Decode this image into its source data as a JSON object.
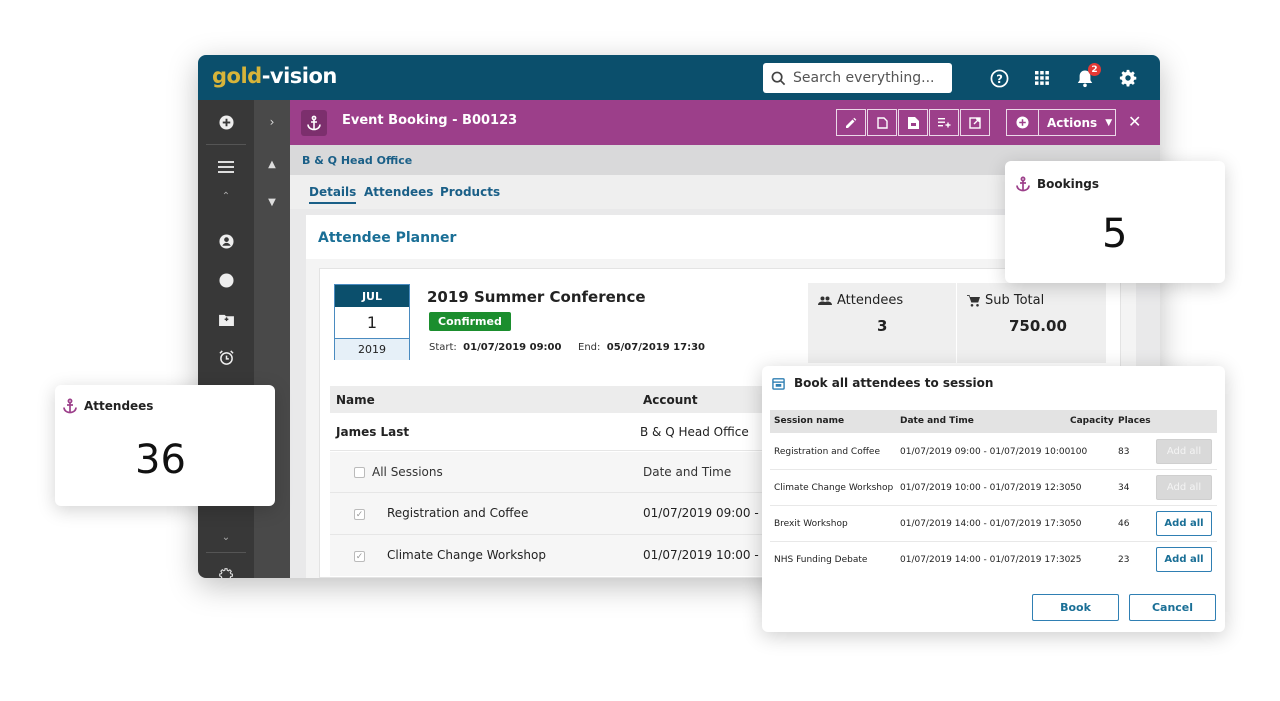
{
  "app": {
    "logo_gold": "gold",
    "logo_rest": "-vision",
    "search_placeholder": "Search everything...",
    "notification_count": "2",
    "colors": {
      "topbar": "#0b4f6c",
      "record_bar": "#9c3f8a",
      "confirmed": "#1b8e2e",
      "link": "#1a5f87"
    }
  },
  "record": {
    "title": "Event Booking - B00123",
    "actions_label": "Actions",
    "breadcrumb": "B & Q Head Office",
    "tabs": [
      "Details",
      "Attendees",
      "Products"
    ]
  },
  "planner": {
    "title": "Attendee Planner",
    "date": {
      "month": "JUL",
      "day": "1",
      "year": "2019"
    },
    "event_name": "2019 Summer Conference",
    "status": "Confirmed",
    "start_label": "Start:",
    "start_value": "01/07/2019 09:00",
    "end_label": "End:",
    "end_value": "05/07/2019 17:30",
    "stats": {
      "attendees_label": "Attendees",
      "attendees_value": "3",
      "subtotal_label": "Sub Total",
      "subtotal_value": "750.00"
    },
    "table": {
      "col_name": "Name",
      "col_account": "Account",
      "attendee_name": "James Last",
      "attendee_account": "B & Q Head Office",
      "all_sessions": "All Sessions",
      "col_datetime": "Date and Time",
      "sessions": [
        {
          "name": "Registration and Coffee",
          "datetime": "01/07/2019 09:00 - 0"
        },
        {
          "name": "Climate Change Workshop",
          "datetime": "01/07/2019 10:00 - 0"
        }
      ]
    }
  },
  "cards": {
    "bookings": {
      "label": "Bookings",
      "value": "5"
    },
    "attendees": {
      "label": "Attendees",
      "value": "36"
    }
  },
  "dialog": {
    "title": "Book all attendees to session",
    "headers": {
      "session": "Session name",
      "datetime": "Date and Time",
      "capacity": "Capacity",
      "places": "Places"
    },
    "rows": [
      {
        "session": "Registration and Coffee",
        "datetime": "01/07/2019 09:00 - 01/07/2019 10:00",
        "capacity": "100",
        "places": "83",
        "button": "Add all",
        "enabled": false
      },
      {
        "session": "Climate Change Workshop",
        "datetime": "01/07/2019 10:00 - 01/07/2019 12:30",
        "capacity": "50",
        "places": "34",
        "button": "Add all",
        "enabled": false
      },
      {
        "session": "Brexit Workshop",
        "datetime": "01/07/2019 14:00 - 01/07/2019 17:30",
        "capacity": "50",
        "places": "46",
        "button": "Add all",
        "enabled": true
      },
      {
        "session": "NHS Funding Debate",
        "datetime": "01/07/2019 14:00 - 01/07/2019 17:30",
        "capacity": "25",
        "places": "23",
        "button": "Add all",
        "enabled": true
      }
    ],
    "book_label": "Book",
    "cancel_label": "Cancel"
  }
}
